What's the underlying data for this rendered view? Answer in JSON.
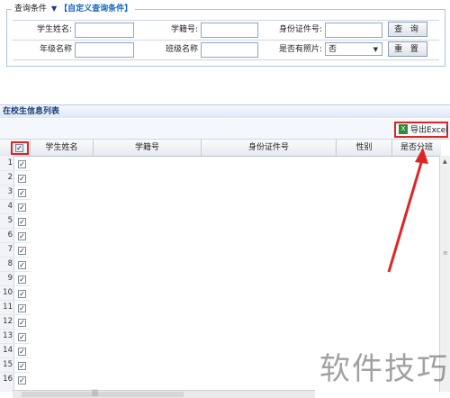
{
  "query": {
    "legend": "查询条件",
    "custom_link": "【自定义查询条件】",
    "student_name_label": "学生姓名:",
    "student_id_label": "学籍号:",
    "id_card_label": "身份证件号:",
    "grade_label": "年级名称",
    "class_label": "班级名称",
    "photo_label": "是否有照片:",
    "photo_value": "否",
    "search_button": "查 询",
    "reset_button": "重 置"
  },
  "list": {
    "title": "在校生信息列表",
    "export_button": "导出Excel",
    "columns": [
      "学生姓名",
      "学籍号",
      "身份证件号",
      "性别",
      "是否分班"
    ],
    "row_numbers": [
      "1",
      "2",
      "3",
      "4",
      "5",
      "6",
      "7",
      "8",
      "9",
      "10",
      "11",
      "12",
      "13",
      "14",
      "15",
      "16"
    ],
    "check_mark": "✓"
  },
  "watermark": "软件技巧",
  "colors": {
    "highlight": "#e02424",
    "header_blue": "#1c3d77",
    "link_blue": "#1565c0"
  }
}
